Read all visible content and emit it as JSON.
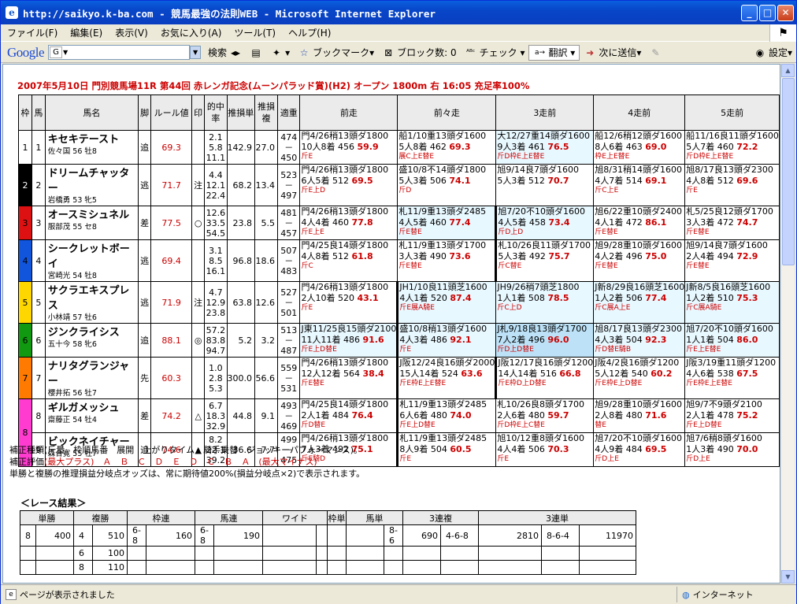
{
  "window": {
    "title": "http://saikyo.k-ba.com - 競馬最強の法則WEB - Microsoft Internet Explorer",
    "buttons": [
      "_",
      "□",
      "✕"
    ]
  },
  "menu": [
    "ファイル(F)",
    "編集(E)",
    "表示(V)",
    "お気に入り(A)",
    "ツール(T)",
    "ヘルプ(H)"
  ],
  "toolbar": {
    "google": "Google",
    "search_btn": "検索",
    "bookmark": "ブックマーク▾",
    "block": "ブロック数: 0",
    "check": "チェック ▾",
    "translate": "翻訳 ▾",
    "sendto": "次に送信▾",
    "settings": "設定▾"
  },
  "race": {
    "header": "2007年5月10日 門別競馬場11R 第44回 赤レンガ記念(ムーンパラッド賞)(H2) オープン 1800m 右 16:05 充足率100%"
  },
  "table": {
    "headers": [
      "枠",
      "馬",
      "馬名",
      "脚",
      "ルール値",
      "印",
      "的中率",
      "推損単",
      "推損複",
      "適重",
      "前走",
      "前々走",
      "3走前",
      "4走前",
      "5走前"
    ],
    "colors": {
      "1": "#ffffff",
      "2": "#000000",
      "3": "#dd1111",
      "4": "#1155dd",
      "5": "#ffd700",
      "6": "#119911",
      "7": "#ff7a00",
      "8": "#ff3ccf"
    },
    "rows": [
      {
        "waku": "1",
        "uma": "1",
        "name": "キセキテースト",
        "jockey": "佐々国 56 牡8",
        "kyaku": "追",
        "rule": "69.3",
        "mark": "",
        "hit": [
          "2.1",
          "5.8",
          "11.1"
        ],
        "tan": "142.9",
        "fuku": "27.0",
        "w": [
          "474",
          "－",
          "450"
        ],
        "past": [
          {
            "l1": "門4/26稍13頭ダ1800",
            "l2": "10人8着 456",
            "v": "59.9",
            "l3": "斤E"
          },
          {
            "l1": "船1/10重13頭ダ1600",
            "l2": "5人8着 462",
            "v": "69.3",
            "l3": "展C上E替E"
          },
          {
            "l1": "大12/27重14頭ダ1600",
            "l2": "9人3着 461",
            "v": "76.5",
            "l3": "斤D枠E上E替E"
          },
          {
            "l1": "船12/6稍12頭ダ1600",
            "l2": "8人6着 463",
            "v": "69.0",
            "l3": "枠E上E替E"
          },
          {
            "l1": "船11/16良11頭ダ1600",
            "l2": "5人7着 460",
            "v": "72.2",
            "l3": "斤D枠E上E替E"
          }
        ]
      },
      {
        "waku": "2",
        "uma": "2",
        "name": "ドリームチャッター",
        "jockey": "岩橋勇 53 牝5",
        "kyaku": "逃",
        "rule": "71.7",
        "mark": "注",
        "hit": [
          "4.4",
          "12.1",
          "22.4"
        ],
        "tan": "68.2",
        "fuku": "13.4",
        "w": [
          "523",
          "－",
          "497"
        ],
        "past": [
          {
            "l1": "門4/26稍13頭ダ1800",
            "l2": "6人5着 512",
            "v": "69.5",
            "l3": "斤E上D"
          },
          {
            "l1": "盛10/8不14頭ダ1800",
            "l2": "5人3着 506",
            "v": "74.1",
            "l3": "斤D"
          },
          {
            "l1": "旭9/14良7頭ダ1600",
            "l2": "5人3着 512",
            "v": "70.7",
            "l3": ""
          },
          {
            "l1": "旭8/31稍14頭ダ1600",
            "l2": "4人7着 514",
            "v": "69.1",
            "l3": "斤C上E"
          },
          {
            "l1": "旭8/17良13頭ダ2300",
            "l2": "4人8着 512",
            "v": "69.6",
            "l3": "斤E"
          }
        ]
      },
      {
        "waku": "3",
        "uma": "3",
        "name": "オースミシュネル",
        "jockey": "服部茂 55 セ8",
        "kyaku": "差",
        "rule": "77.5",
        "mark": "○",
        "hit": [
          "12.6",
          "33.5",
          "54.5"
        ],
        "tan": "23.8",
        "fuku": "5.5",
        "w": [
          "481",
          "－",
          "457"
        ],
        "past": [
          {
            "l1": "門4/26稍13頭ダ1800",
            "l2": "4人4着 460",
            "v": "77.8",
            "l3": "斤E上E"
          },
          {
            "l1": "札11/9重13頭ダ2485",
            "l2": "4人5着 460",
            "v": "77.4",
            "l3": "斤E替E"
          },
          {
            "l1": "旭7/20不10頭ダ1600",
            "l2": "4人5着 458",
            "v": "73.4",
            "l3": "斤D上D"
          },
          {
            "l1": "旭6/22重10頭ダ2400",
            "l2": "4人1着 472",
            "v": "86.1",
            "l3": "斤E替E"
          },
          {
            "l1": "札5/25良12頭ダ1700",
            "l2": "3人3着 472",
            "v": "74.7",
            "l3": "斤E替E"
          }
        ]
      },
      {
        "waku": "4",
        "uma": "4",
        "name": "シークレットボーイ",
        "jockey": "宮崎光 54 牡8",
        "kyaku": "逃",
        "rule": "69.4",
        "mark": "",
        "hit": [
          "3.1",
          "8.5",
          "16.1"
        ],
        "tan": "96.8",
        "fuku": "18.6",
        "w": [
          "507",
          "－",
          "483"
        ],
        "past": [
          {
            "l1": "門4/25良14頭ダ1800",
            "l2": "4人8着 512",
            "v": "61.8",
            "l3": "斤C"
          },
          {
            "l1": "札11/9重13頭ダ1700",
            "l2": "3人3着 490",
            "v": "73.6",
            "l3": "斤E替E"
          },
          {
            "l1": "札10/26良11頭ダ1700",
            "l2": "5人3着 492",
            "v": "75.7",
            "l3": "斤C替E"
          },
          {
            "l1": "旭9/28重10頭ダ1600",
            "l2": "4人2着 496",
            "v": "75.0",
            "l3": "斤E替E"
          },
          {
            "l1": "旭9/14良7頭ダ1600",
            "l2": "2人4着 494",
            "v": "72.9",
            "l3": "斤E替E"
          }
        ]
      },
      {
        "waku": "5",
        "uma": "5",
        "name": "サクラエキスプレス",
        "jockey": "小林靖 57 牡6",
        "kyaku": "逃",
        "rule": "71.9",
        "mark": "注",
        "hit": [
          "4.7",
          "12.9",
          "23.8"
        ],
        "tan": "63.8",
        "fuku": "12.6",
        "w": [
          "527",
          "－",
          "501"
        ],
        "past": [
          {
            "l1": "門4/26稍13頭ダ1800",
            "l2": "2人10着 520",
            "v": "43.1",
            "l3": "斤E"
          },
          {
            "l1": "JH1/10良11頭芝1600",
            "l2": "4人1着 520",
            "v": "87.4",
            "l3": "斤E展A騎E"
          },
          {
            "l1": "JH9/26稍7頭芝1800",
            "l2": "1人1着 508",
            "v": "78.5",
            "l3": "斤C上D"
          },
          {
            "l1": "J新8/29良16頭芝1600",
            "l2": "1人2着 506",
            "v": "77.4",
            "l3": "斤C展A上E"
          },
          {
            "l1": "J新8/5良16頭芝1600",
            "l2": "1人2着 510",
            "v": "75.3",
            "l3": "斤C展A騎E"
          }
        ]
      },
      {
        "waku": "6",
        "uma": "6",
        "name": "ジンクライシス",
        "jockey": "五十今 58 牝6",
        "kyaku": "追",
        "rule": "88.1",
        "mark": "◎",
        "hit": [
          "57.2",
          "83.8",
          "94.7"
        ],
        "tan": "5.2",
        "fuku": "3.2",
        "w": [
          "513",
          "－",
          "487"
        ],
        "past": [
          {
            "l1": "J東11/25良15頭ダ2100",
            "l2": "11人11着 486",
            "v": "91.6",
            "l3": "斤E上D替E"
          },
          {
            "l1": "盛10/8稍13頭ダ1600",
            "l2": "4人3着 486",
            "v": "92.1",
            "l3": "斤E"
          },
          {
            "l1": "J札9/18良13頭ダ1700",
            "l2": "7人2着 496",
            "v": "96.0",
            "l3": "斤D上D替E"
          },
          {
            "l1": "旭8/17良13頭ダ2300",
            "l2": "4人3着 504",
            "v": "92.3",
            "l3": "斤D替E騎B"
          },
          {
            "l1": "旭7/20不10頭ダ1600",
            "l2": "1人1着 504",
            "v": "86.0",
            "l3": "斤E上E替E"
          }
        ]
      },
      {
        "waku": "7",
        "uma": "7",
        "name": "ナリタグランジャー",
        "jockey": "櫻井拓 56 牡7",
        "kyaku": "先",
        "rule": "60.3",
        "mark": "",
        "hit": [
          "1.0",
          "2.8",
          "5.3"
        ],
        "tan": "300.0",
        "fuku": "56.6",
        "w": [
          "559",
          "－",
          "531"
        ],
        "past": [
          {
            "l1": "門4/26稍13頭ダ1800",
            "l2": "12人12着 564",
            "v": "38.4",
            "l3": "斤E替E"
          },
          {
            "l1": "J阪12/24良16頭ダ2000",
            "l2": "15人14着 524",
            "v": "63.6",
            "l3": "斤E枠E上E替E"
          },
          {
            "l1": "J阪12/17良16頭ダ1200",
            "l2": "14人14着 516",
            "v": "66.8",
            "l3": "斤E枠D上D替E"
          },
          {
            "l1": "J阪4/2良16頭ダ1200",
            "l2": "5人12着 540",
            "v": "60.2",
            "l3": "斤E枠E上D替E"
          },
          {
            "l1": "J阪3/19重11頭ダ1200",
            "l2": "4人6着 538",
            "v": "67.5",
            "l3": "斤E枠E上E替E"
          }
        ]
      },
      {
        "waku": "8",
        "uma": "8",
        "name": "ギルガメッシュ",
        "jockey": "齋藤正 54 牡4",
        "kyaku": "差",
        "rule": "74.2",
        "mark": "△",
        "hit": [
          "6.7",
          "18.3",
          "32.9"
        ],
        "tan": "44.8",
        "fuku": "9.1",
        "w": [
          "493",
          "－",
          "469"
        ],
        "past": [
          {
            "l1": "門4/25良14頭ダ1800",
            "l2": "2人1着 484",
            "v": "76.4",
            "l3": "斤D替E"
          },
          {
            "l1": "札11/9重13頭ダ2485",
            "l2": "6人6着 480",
            "v": "74.0",
            "l3": "斤E上D替E"
          },
          {
            "l1": "札10/26良8頭ダ1700",
            "l2": "2人6着 480",
            "v": "59.7",
            "l3": "斤D枠E上C替E"
          },
          {
            "l1": "旭9/28重10頭ダ1600",
            "l2": "2人8着 480",
            "v": "71.6",
            "l3": "替E"
          },
          {
            "l1": "旭9/7不9頭ダ2100",
            "l2": "2人1着 478",
            "v": "75.2",
            "l3": "斤E上D替E"
          }
        ]
      },
      {
        "waku": "8",
        "uma": "9",
        "name": "ビックネイチャー",
        "jockey": "森合寛 55 牡7",
        "kyaku": "追",
        "rule": "74.6",
        "mark": "▲",
        "hit": [
          "8.2",
          "22.1",
          "39.2"
        ],
        "tan": "36.6",
        "fuku": "7.7",
        "w": [
          "499",
          "－",
          "475"
        ],
        "past": [
          {
            "l1": "門4/26稍13頭ダ1800",
            "l2": "7人3着 492",
            "v": "75.1",
            "l3": "斤E騎D"
          },
          {
            "l1": "札11/9重13頭ダ2485",
            "l2": "8人9着 504",
            "v": "60.5",
            "l3": "斤E"
          },
          {
            "l1": "旭10/12重8頭ダ1600",
            "l2": "4人4着 506",
            "v": "70.3",
            "l3": "斤E"
          },
          {
            "l1": "旭7/20不10頭ダ1600",
            "l2": "4人9着 484",
            "v": "69.5",
            "l3": "斤D上E"
          },
          {
            "l1": "旭7/6稍8頭ダ1600",
            "l2": "1人3着 490",
            "v": "70.0",
            "l3": "斤D上E"
          }
        ]
      }
    ]
  },
  "notes": {
    "n1": "補正種類(斤量　枠順馬番　展開　上がりタイム　騎手乗替　ジョッキーパフォーマンス)。",
    "n2_pre": "補正評価",
    "n2_lo": "(最大プラス)　Ａ　Ｂ　Ｃ　Ｄ　Ｅ　Ｄ　Ｃ　Ｂ　Ａ　(最大マイナス)",
    "n3": "単勝と複勝の推理損益分岐点オッズは、常に期待値200%(損益分岐点×2)で表示されます。"
  },
  "results": {
    "title": "＜レース結果＞",
    "headers": [
      "単勝",
      "複勝",
      "枠連",
      "馬連",
      "ワイド",
      "枠単",
      "馬単",
      "3連複",
      "3連単"
    ],
    "rows": [
      [
        "8",
        "400",
        "4",
        "510",
        "6-8",
        "160",
        "6-8",
        "190",
        "",
        "",
        "",
        "",
        "8-6",
        "690",
        "4-6-8",
        "2810",
        "8-6-4",
        "11970"
      ],
      [
        "",
        "",
        "6",
        "100",
        "",
        "",
        "",
        "",
        "",
        "",
        "",
        "",
        "",
        "",
        "",
        "",
        "",
        ""
      ],
      [
        "",
        "",
        "8",
        "110",
        "",
        "",
        "",
        "",
        "",
        "",
        "",
        "",
        "",
        "",
        "",
        "",
        "",
        ""
      ]
    ]
  },
  "status": {
    "text": "ページが表示されました",
    "zone": "インターネット"
  }
}
